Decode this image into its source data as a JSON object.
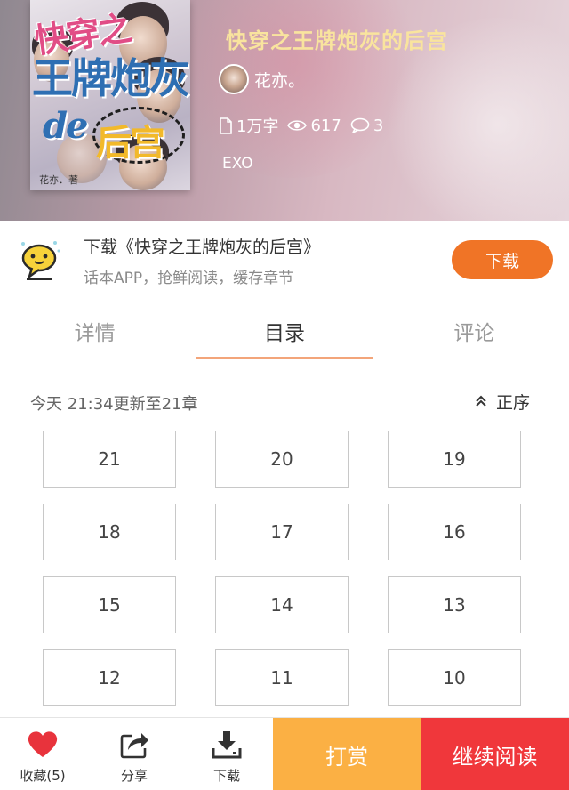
{
  "book": {
    "title": "快穿之王牌炮灰的后宫",
    "author": "花亦。",
    "word_count": "1万字",
    "views": "617",
    "comments": "3",
    "tag": "EXO"
  },
  "cover": {
    "lines": [
      "快穿之",
      "王牌炮灰",
      "de",
      "后宫"
    ],
    "signature": "花亦．著"
  },
  "banner": {
    "title": "下载《快穿之王牌炮灰的后宫》",
    "subtitle": "话本APP，抢鲜阅读，缓存章节",
    "button": "下载"
  },
  "tabs": [
    {
      "label": "详情"
    },
    {
      "label": "目录"
    },
    {
      "label": "评论"
    }
  ],
  "active_tab": "目录",
  "catalog": {
    "update_text": "今天 21:34更新至21章",
    "order_label": "正序",
    "chapters": [
      "21",
      "20",
      "19",
      "18",
      "17",
      "16",
      "15",
      "14",
      "13",
      "12",
      "11",
      "10"
    ]
  },
  "bottom_bar": {
    "favorite_label": "收藏(5)",
    "share_label": "分享",
    "download_label": "下载",
    "reward_label": "打赏",
    "continue_label": "继续阅读"
  },
  "colors": {
    "accent_orange": "#f07426",
    "tab_underline": "#f3a57a",
    "reward_bg": "#fbb044",
    "read_bg": "#f0373b",
    "favorite_red": "#e8333c",
    "title_yellow": "#f9e49e"
  },
  "icons": {
    "word_count": "document-icon",
    "views": "eye-icon",
    "comments": "comment-bubble-icon",
    "order": "double-chevron-up-icon",
    "favorite": "heart-icon",
    "share": "share-icon",
    "download": "download-icon",
    "app": "chat-bubble-app-icon"
  }
}
